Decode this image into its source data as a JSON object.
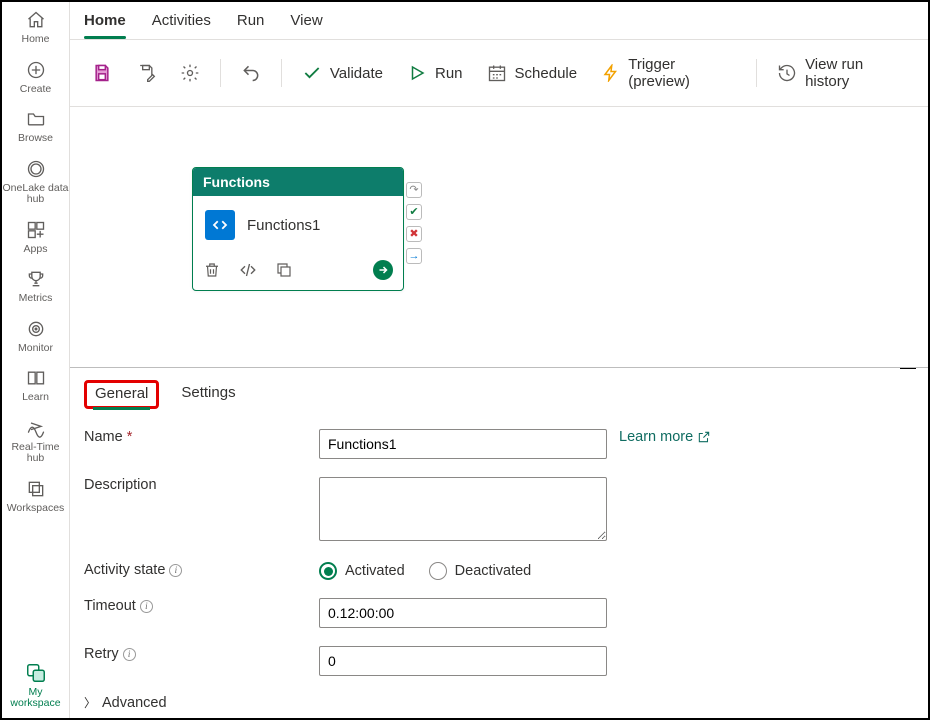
{
  "leftRail": {
    "items": [
      {
        "label": "Home",
        "icon": "home"
      },
      {
        "label": "Create",
        "icon": "plus-circle"
      },
      {
        "label": "Browse",
        "icon": "folder"
      },
      {
        "label": "OneLake data hub",
        "icon": "globe"
      },
      {
        "label": "Apps",
        "icon": "apps"
      },
      {
        "label": "Metrics",
        "icon": "trophy"
      },
      {
        "label": "Monitor",
        "icon": "target"
      },
      {
        "label": "Learn",
        "icon": "book"
      },
      {
        "label": "Real-Time hub",
        "icon": "stream"
      },
      {
        "label": "Workspaces",
        "icon": "stack"
      },
      {
        "label": "My workspace",
        "icon": "my-ws",
        "active": true
      }
    ]
  },
  "topTabs": {
    "items": [
      {
        "label": "Home",
        "active": true
      },
      {
        "label": "Activities"
      },
      {
        "label": "Run"
      },
      {
        "label": "View"
      }
    ]
  },
  "toolbar": {
    "validate": "Validate",
    "run": "Run",
    "schedule": "Schedule",
    "trigger": "Trigger (preview)",
    "history": "View run history"
  },
  "activityCard": {
    "header": "Functions",
    "name": "Functions1"
  },
  "propPanel": {
    "tabs": {
      "general": "General",
      "settings": "Settings"
    },
    "learnMore": "Learn more",
    "labels": {
      "name": "Name",
      "description": "Description",
      "activityState": "Activity state",
      "timeout": "Timeout",
      "retry": "Retry",
      "advanced": "Advanced"
    },
    "values": {
      "name": "Functions1",
      "description": "",
      "stateActivated": "Activated",
      "stateDeactivated": "Deactivated",
      "timeout": "0.12:00:00",
      "retry": "0"
    }
  }
}
